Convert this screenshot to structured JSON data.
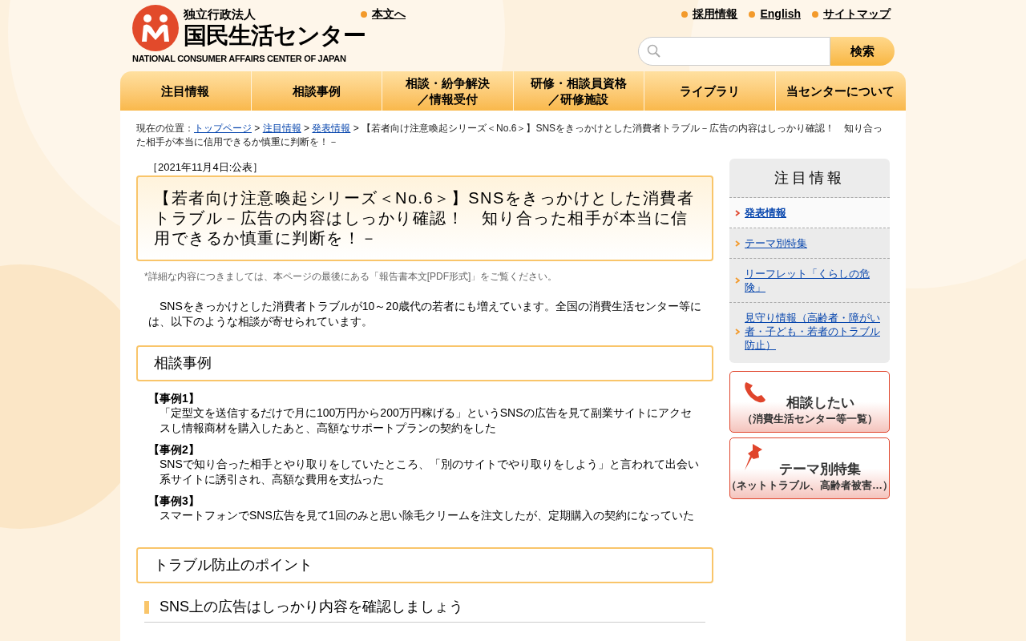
{
  "header": {
    "logo": {
      "org_type": "独立行政法人",
      "name": "国民生活センター",
      "english": "NATIONAL CONSUMER AFFAIRS CENTER OF JAPAN"
    },
    "skip_link": "本文へ",
    "utility_links": [
      "採用情報",
      "English",
      "サイトマップ"
    ],
    "search": {
      "button": "検索"
    }
  },
  "nav": [
    {
      "lines": [
        "注目情報"
      ]
    },
    {
      "lines": [
        "相談事例"
      ]
    },
    {
      "lines": [
        "相談・紛争解決",
        "／情報受付"
      ]
    },
    {
      "lines": [
        "研修・相談員資格",
        "／研修施設"
      ]
    },
    {
      "lines": [
        "ライブラリ"
      ]
    },
    {
      "lines": [
        "当センターについて"
      ]
    }
  ],
  "breadcrumb": {
    "label": "現在の位置：",
    "links": [
      "トップページ",
      "注目情報",
      "発表情報"
    ],
    "separator": ">",
    "current": "【若者向け注意喚起シリーズ＜No.6＞】SNSをきっかけとした消費者トラブル－広告の内容はしっかり確認！　知り合った相手が本当に信用できるか慎重に判断を！－"
  },
  "article": {
    "date": "［2021年11月4日:公表］",
    "title": "【若者向け注意喚起シリーズ＜No.6＞】SNSをきっかけとした消費者トラブル－広告の内容はしっかり確認！　知り合った相手が本当に信用できるか慎重に判断を！－",
    "note": "*詳細な内容につきましては、本ページの最後にある「報告書本文[PDF形式]」をご覧ください。",
    "intro": "　SNSをきっかけとした消費者トラブルが10～20歳代の若者にも増えています。全国の消費生活センター等には、以下のような相談が寄せられています。",
    "sections": [
      {
        "heading": "相談事例",
        "cases": [
          {
            "label": "【事例1】",
            "text": "「定型文を送信するだけで月に100万円から200万円稼げる」というSNSの広告を見て副業サイトにアクセスし情報商材を購入したあと、高額なサポートプランの契約をした"
          },
          {
            "label": "【事例2】",
            "text": "SNSで知り合った相手とやり取りをしていたところ、「別のサイトでやり取りをしよう」と言われて出会い系サイトに誘引され、高額な費用を支払った"
          },
          {
            "label": "【事例3】",
            "text": "スマートフォンでSNS広告を見て1回のみと思い除毛クリームを注文したが、定期購入の契約になっていた"
          }
        ]
      },
      {
        "heading": "トラブル防止のポイント",
        "subheading": "SNS上の広告はしっかり内容を確認しましょう"
      }
    ]
  },
  "sidebar": {
    "title": "注目情報",
    "items": [
      {
        "label": "発表情報",
        "selected": true
      },
      {
        "label": "テーマ別特集",
        "selected": false
      },
      {
        "label": "リーフレット「くらしの危険」",
        "selected": false
      },
      {
        "label": "見守り情報（高齢者・障がい者・子ども・若者のトラブル防止）",
        "selected": false
      }
    ],
    "banners": [
      {
        "kind": "phone",
        "title": "相談したい",
        "subtitle": "（消費生活センター等一覧）"
      },
      {
        "kind": "pin",
        "title": "テーマ別特集",
        "subtitle": "（ネットトラブル、高齢者被害…）"
      }
    ]
  }
}
